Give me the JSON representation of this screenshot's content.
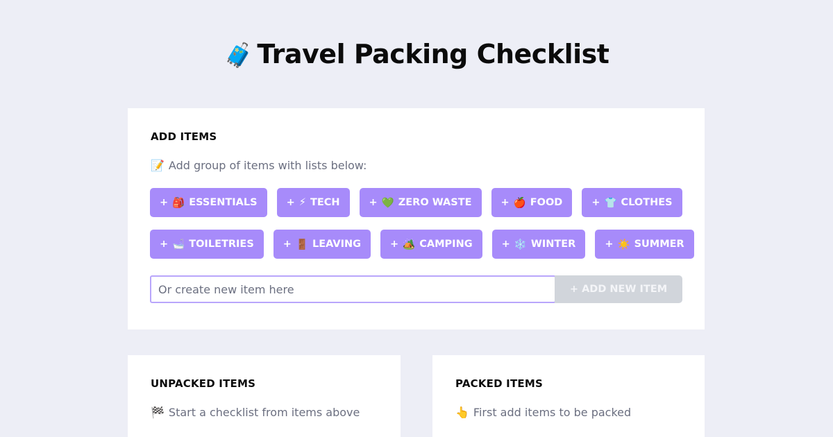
{
  "header": {
    "icon": "luggage-icon",
    "emoji": "🧳",
    "title": "Travel Packing Checklist"
  },
  "add_items": {
    "heading": "ADD ITEMS",
    "hint_emoji": "📝",
    "hint": "Add group of items with lists below:",
    "chip_prefix": "+",
    "groups_row1": [
      {
        "emoji": "🎒",
        "label": "ESSENTIALS"
      },
      {
        "emoji": "⚡",
        "label": "TECH"
      },
      {
        "emoji": "💚",
        "label": "ZERO WASTE"
      },
      {
        "emoji": "🍎",
        "label": "FOOD"
      },
      {
        "emoji": "👕",
        "label": "CLOTHES"
      }
    ],
    "groups_row2": [
      {
        "emoji": "🛁",
        "label": "TOILETRIES"
      },
      {
        "emoji": "🚪",
        "label": "LEAVING"
      },
      {
        "emoji": "🏕️",
        "label": "CAMPING"
      },
      {
        "emoji": "❄️",
        "label": "WINTER"
      },
      {
        "emoji": "☀️",
        "label": "SUMMER"
      }
    ],
    "new_item_placeholder": "Or create new item here",
    "new_item_value": "",
    "add_button_label": "+ ADD NEW ITEM"
  },
  "unpacked": {
    "heading": "UNPACKED ITEMS",
    "hint_emoji": "🏁",
    "hint": "Start a checklist from items above"
  },
  "packed": {
    "heading": "PACKED ITEMS",
    "hint_emoji": "👆",
    "hint": "First add items to be packed"
  },
  "colors": {
    "background": "#edeef6",
    "chip": "#a78bfa",
    "input_border": "#b9a6fb",
    "disabled_button": "#d1d5db"
  }
}
